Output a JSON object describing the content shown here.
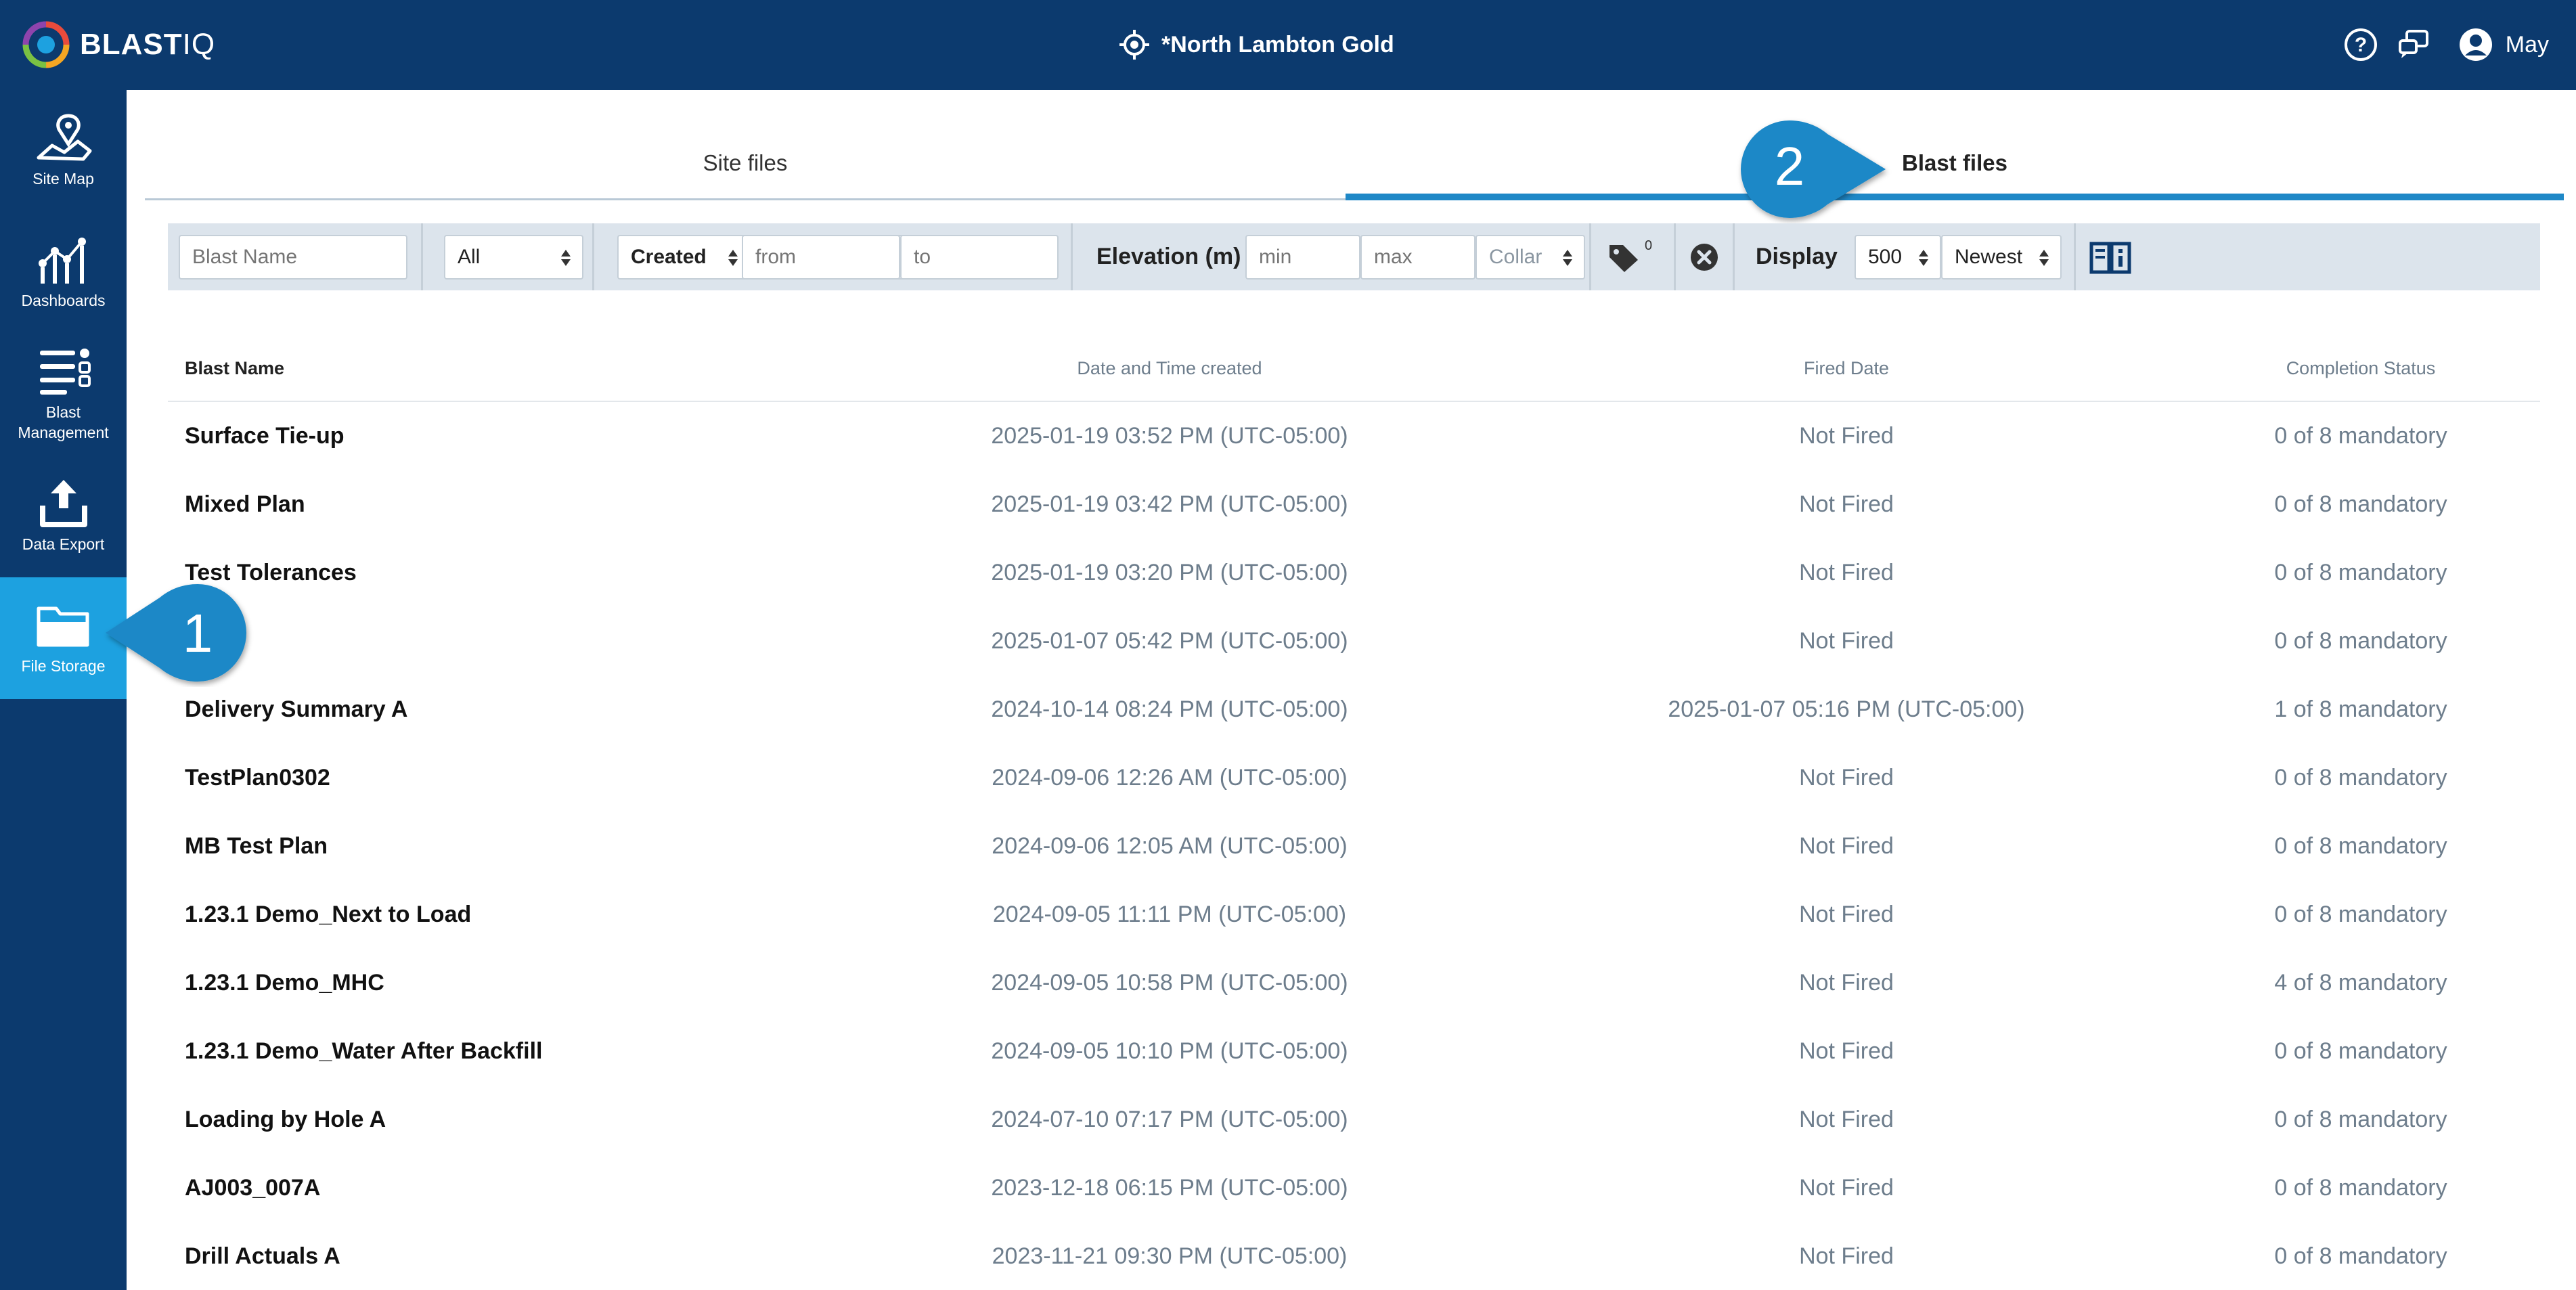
{
  "app": {
    "logo_text_main": "BLAST",
    "logo_text_sub": "IQ",
    "site_name": "*North Lambton Gold",
    "user_name": "May",
    "icons": [
      "blastiq-logo-icon",
      "crosshair-icon",
      "help-icon",
      "chat-icon",
      "user-avatar-icon"
    ]
  },
  "sidebar": {
    "items": [
      {
        "label": "Site Map",
        "icon": "map-icon"
      },
      {
        "label": "Dashboards",
        "icon": "dashboard-chart-icon"
      },
      {
        "label": "Blast Management",
        "icon": "list-manage-icon"
      },
      {
        "label": "Data Export",
        "icon": "upload-icon"
      },
      {
        "label": "File Storage",
        "icon": "folder-icon",
        "active": true
      }
    ]
  },
  "tabs": [
    {
      "label": "Site files",
      "active": false
    },
    {
      "label": "Blast files",
      "active": true
    }
  ],
  "filters": {
    "blast_name_placeholder": "Blast Name",
    "type_value": "All",
    "date_field_value": "Created",
    "from_placeholder": "from",
    "to_placeholder": "to",
    "elevation_label": "Elevation (m)",
    "min_placeholder": "min",
    "max_placeholder": "max",
    "elevation_ref_value": "Collar",
    "tag_count": "0",
    "display_label": "Display",
    "limit_value": "500",
    "sort_value": "Newest"
  },
  "table": {
    "headers": {
      "name": "Blast Name",
      "created": "Date and Time created",
      "fired": "Fired Date",
      "status": "Completion Status"
    },
    "rows": [
      {
        "name": "Surface Tie-up",
        "created": "2025-01-19 03:52 PM (UTC-05:00)",
        "fired": "Not Fired",
        "status": "0 of 8 mandatory"
      },
      {
        "name": "Mixed Plan",
        "created": "2025-01-19 03:42 PM (UTC-05:00)",
        "fired": "Not Fired",
        "status": "0 of 8 mandatory"
      },
      {
        "name": "Test Tolerances",
        "created": "2025-01-19 03:20 PM (UTC-05:00)",
        "fired": "Not Fired",
        "status": "0 of 8 mandatory"
      },
      {
        "name": "",
        "created": "2025-01-07 05:42 PM (UTC-05:00)",
        "fired": "Not Fired",
        "status": "0 of 8 mandatory"
      },
      {
        "name": "Delivery Summary A",
        "created": "2024-10-14 08:24 PM (UTC-05:00)",
        "fired": "2025-01-07 05:16 PM (UTC-05:00)",
        "status": "1 of 8 mandatory"
      },
      {
        "name": "TestPlan0302",
        "created": "2024-09-06 12:26 AM (UTC-05:00)",
        "fired": "Not Fired",
        "status": "0 of 8 mandatory"
      },
      {
        "name": "MB Test Plan",
        "created": "2024-09-06 12:05 AM (UTC-05:00)",
        "fired": "Not Fired",
        "status": "0 of 8 mandatory"
      },
      {
        "name": "1.23.1 Demo_Next to Load",
        "created": "2024-09-05 11:11 PM (UTC-05:00)",
        "fired": "Not Fired",
        "status": "0 of 8 mandatory"
      },
      {
        "name": "1.23.1 Demo_MHC",
        "created": "2024-09-05 10:58 PM (UTC-05:00)",
        "fired": "Not Fired",
        "status": "4 of 8 mandatory"
      },
      {
        "name": "1.23.1 Demo_Water After Backfill",
        "created": "2024-09-05 10:10 PM (UTC-05:00)",
        "fired": "Not Fired",
        "status": "0 of 8 mandatory"
      },
      {
        "name": "Loading by Hole A",
        "created": "2024-07-10 07:17 PM (UTC-05:00)",
        "fired": "Not Fired",
        "status": "0 of 8 mandatory"
      },
      {
        "name": "AJ003_007A",
        "created": "2023-12-18 06:15 PM (UTC-05:00)",
        "fired": "Not Fired",
        "status": "0 of 8 mandatory"
      },
      {
        "name": "Drill Actuals A",
        "created": "2023-11-21 09:30 PM (UTC-05:00)",
        "fired": "Not Fired",
        "status": "0 of 8 mandatory"
      }
    ]
  },
  "callouts": [
    {
      "number": "1"
    },
    {
      "number": "2"
    }
  ],
  "colors": {
    "navy": "#0c3a6e",
    "accent": "#1da1e0",
    "tab_underline": "#1f88c7",
    "filter_bg": "#dce4ec"
  }
}
